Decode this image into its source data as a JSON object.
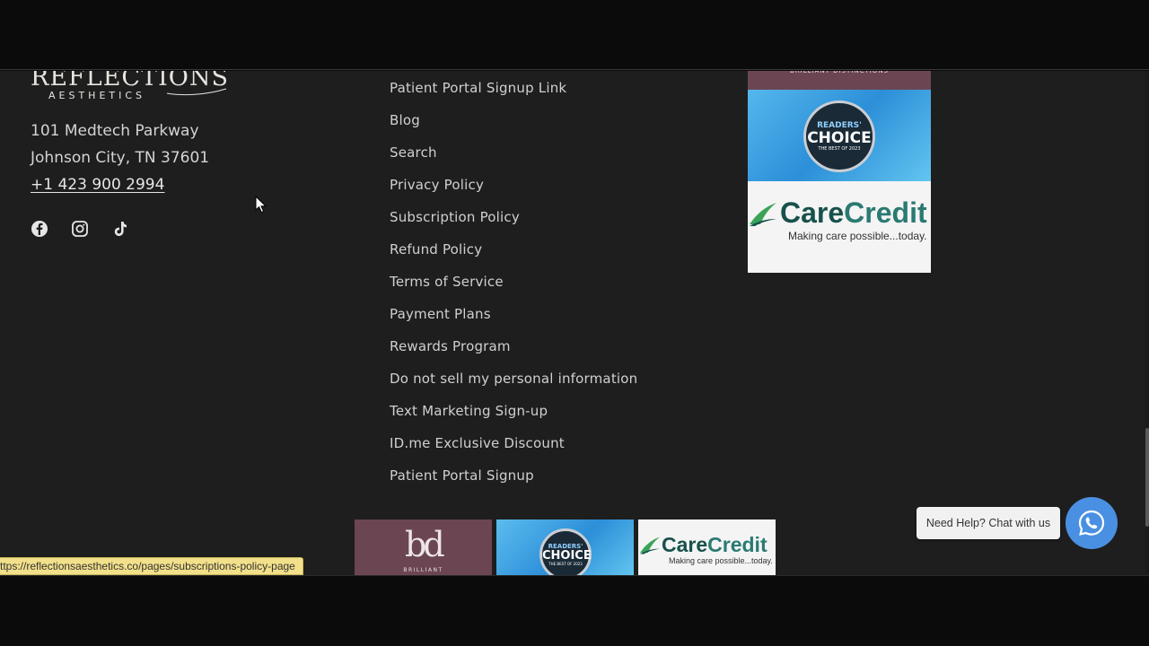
{
  "brand": {
    "logo_main": "REFLECTIONS",
    "logo_sub": "AESTHETICS"
  },
  "address": {
    "line1": "101 Medtech Parkway",
    "line2": "Johnson City, TN 37601",
    "phone": "+1 423 900 2994"
  },
  "socials": [
    {
      "name": "facebook-icon"
    },
    {
      "name": "instagram-icon"
    },
    {
      "name": "tiktok-icon"
    }
  ],
  "footer_links": [
    "Patient Portal Signup Link",
    "Blog",
    "Search",
    "Privacy Policy",
    "Subscription Policy",
    "Refund Policy",
    "Terms of Service",
    "Payment Plans",
    "Rewards Program",
    "Do not sell my personal information",
    "Text Marketing Sign-up",
    "ID.me Exclusive Discount",
    "Patient Portal Signup"
  ],
  "badges": {
    "bd_top_text": "BRILLIANT DISTINCTIONS",
    "bd_mark": "bd",
    "bd_word": "BRILLIANT",
    "readers_line1": "READERS'",
    "readers_line2": "CHOICE",
    "readers_line3": "THE BEST OF 2023",
    "care_word_a": "Care",
    "care_word_b": "Credit",
    "care_tagline": "Making care possible...today."
  },
  "chat": {
    "label": "Need Help? Chat with us",
    "icon": "whatsapp-icon"
  },
  "status_url": "ttps://reflectionsaesthetics.co/pages/subscriptions-policy-page",
  "colors": {
    "footer_bg": "#1e1e1e",
    "bd_purple": "#6b4652",
    "chat_blue": "#4a90e2",
    "status_bg": "#f2e08a"
  }
}
